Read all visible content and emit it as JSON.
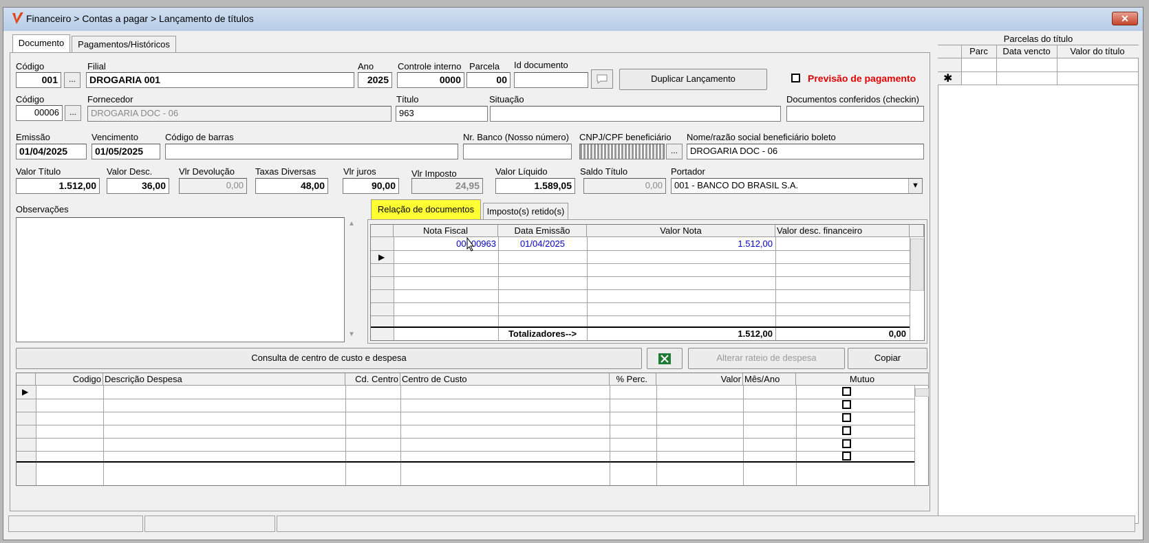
{
  "window": {
    "title": "Financeiro > Contas a pagar > Lançamento de títulos",
    "close_symbol": "✕"
  },
  "tabs": [
    "Documento",
    "Pagamentos/Históricos"
  ],
  "row1": {
    "codigo_label": "Código",
    "codigo_value": "001",
    "filial_label": "Filial",
    "filial_value": "DROGARIA 001",
    "ano_label": "Ano",
    "ano_value": "2025",
    "controle_label": "Controle interno",
    "controle_value": "0000",
    "parcela_label": "Parcela",
    "parcela_value": "00",
    "iddoc_label": "Id documento",
    "iddoc_value": "",
    "duplicar_button": "Duplicar Lançamento",
    "previsao_label": "Previsão de pagamento"
  },
  "row2": {
    "codigo_label": "Código",
    "codigo_value": "00006",
    "fornecedor_label": "Fornecedor",
    "fornecedor_value": "DROGARIA DOC - 06",
    "titulo_label": "Título",
    "titulo_value": "963",
    "situacao_label": "Situação",
    "situacao_value": "",
    "checkin_label": "Documentos conferidos (checkin)",
    "checkin_value": ""
  },
  "row3": {
    "emissao_label": "Emissão",
    "emissao_value": "01/04/2025",
    "vencimento_label": "Vencimento",
    "vencimento_value": "01/05/2025",
    "barras_label": "Código de barras",
    "barras_value": "",
    "nrbanco_label": "Nr. Banco (Nosso número)",
    "nrbanco_value": "",
    "cnpj_label": "CNPJ/CPF beneficiário",
    "nome_label": "Nome/razão social beneficiário boleto",
    "nome_value": "DROGARIA DOC - 06"
  },
  "row4": {
    "valor_titulo_label": "Valor Título",
    "valor_titulo_value": "1.512,00",
    "valor_desc_label": "Valor Desc.",
    "valor_desc_value": "36,00",
    "vlr_devolucao_label": "Vlr Devolução",
    "vlr_devolucao_value": "0,00",
    "taxas_label": "Taxas Diversas",
    "taxas_value": "48,00",
    "juros_label": "Vlr juros",
    "juros_value": "90,00",
    "imposto_label": "Vlr Imposto",
    "imposto_value": "24,95",
    "liquido_label": "Valor Líquido",
    "liquido_value": "1.589,05",
    "saldo_label": "Saldo Título",
    "saldo_value": "0,00",
    "portador_label": "Portador",
    "portador_value": "001 - BANCO DO BRASIL S.A."
  },
  "observacoes_label": "Observações",
  "doc_tabs": [
    "Relação de documentos",
    "Imposto(s) retido(s)"
  ],
  "doc_grid": {
    "headers": [
      "Nota Fiscal",
      "Data Emissão",
      "Valor Nota",
      "Valor desc. financeiro"
    ],
    "row": {
      "nota": "00000963",
      "data": "01/04/2025",
      "valor": "1.512,00"
    },
    "totals_label": "Totalizadores-->",
    "totals_valor": "1.512,00",
    "totals_desc": "0,00"
  },
  "buttons": {
    "consulta": "Consulta de centro de custo e despesa",
    "alterar": "Alterar rateio de despesa",
    "copiar": "Copiar"
  },
  "cost_grid": {
    "headers": [
      "Codigo",
      "Descrição Despesa",
      "Cd. Centro",
      "Centro de Custo",
      "% Perc.",
      "Valor",
      "Mês/Ano",
      "Mutuo"
    ]
  },
  "parcelas": {
    "title": "Parcelas do título",
    "headers": [
      "Parc",
      "Data vencto",
      "Valor do título"
    ],
    "new_row_symbol": "✱"
  },
  "colors": {
    "highlight_tab": "#ffff33",
    "previsao": "#e00000",
    "link": "#0000cc"
  }
}
